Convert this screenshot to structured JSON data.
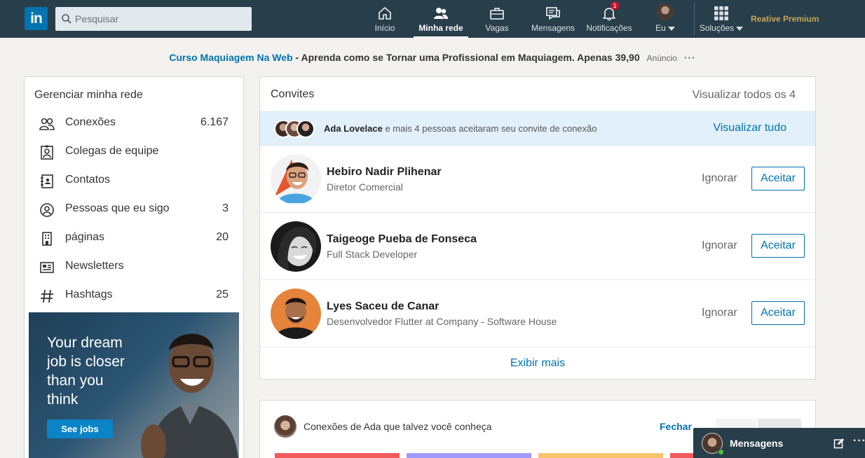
{
  "nav": {
    "logo": "in",
    "search_placeholder": "Pesquisar",
    "items": [
      {
        "label": "Início",
        "icon": "home-icon"
      },
      {
        "label": "Minha rede",
        "icon": "network-icon",
        "active": true
      },
      {
        "label": "Vagas",
        "icon": "briefcase-icon"
      },
      {
        "label": "Mensagens",
        "icon": "messaging-icon"
      },
      {
        "label": "Notificações",
        "icon": "bell-icon",
        "badge": "1"
      },
      {
        "label": "Eu",
        "icon": "avatar"
      },
      {
        "label": "Soluções",
        "icon": "grid-icon"
      }
    ],
    "premium": "Reative Premium"
  },
  "ad": {
    "link": "Curso Maquiagem Na Web",
    "text": " - Aprenda como se Tornar uma Profissional em Maquiagem. Apenas 39,90",
    "tag": "Anúncio",
    "more": "···"
  },
  "sidebar": {
    "title": "Gerenciar minha rede",
    "items": [
      {
        "label": "Conexões",
        "count": "6.167",
        "icon": "connections-icon"
      },
      {
        "label": "Colegas de equipe",
        "count": "",
        "icon": "teammates-icon"
      },
      {
        "label": "Contatos",
        "count": "",
        "icon": "contacts-icon"
      },
      {
        "label": "Pessoas que eu sigo",
        "count": "3",
        "icon": "following-icon"
      },
      {
        "label": "páginas",
        "count": "20",
        "icon": "pages-icon"
      },
      {
        "label": "Newsletters",
        "count": "",
        "icon": "newsletter-icon"
      },
      {
        "label": "Hashtags",
        "count": "25",
        "icon": "hashtag-icon"
      }
    ],
    "promo": {
      "text": "Your dream job is closer than you think",
      "button": "See jobs"
    }
  },
  "invitations": {
    "title": "Convites",
    "view_all": "Visualizar todos os 4",
    "accepted": {
      "name": "Ada Lovelace",
      "text": " e mais 4 pessoas aceitaram seu convite de conexão",
      "link": "Visualizar tudo"
    },
    "rows": [
      {
        "name": "Hebiro Nadir Plihenar",
        "subtitle": "Diretor Comercial",
        "ignore": "Ignorar",
        "accept": "Aceitar"
      },
      {
        "name": "Taigeoge Pueba de Fonseca",
        "subtitle": "Full Stack Developer",
        "ignore": "Ignorar",
        "accept": "Aceitar"
      },
      {
        "name": "Lyes Saceu de Canar",
        "subtitle": "Desenvolvedor Flutter at Company - Software House",
        "ignore": "Ignorar",
        "accept": "Aceitar"
      }
    ],
    "show_more": "Exibir mais"
  },
  "suggestions": {
    "title": "Conexões de Ada que talvez você conheça",
    "close": "Fechar",
    "prev": "‹",
    "next": "›",
    "strip_colors": [
      "#f15a5a",
      "#a29bfe",
      "#f7c46c",
      "#f15a5a"
    ]
  },
  "messaging": {
    "label": "Mensagens",
    "more": "···"
  },
  "colors": {
    "nav_bg": "#283e4a",
    "accent": "#0073b1",
    "premium": "#c7a757"
  }
}
